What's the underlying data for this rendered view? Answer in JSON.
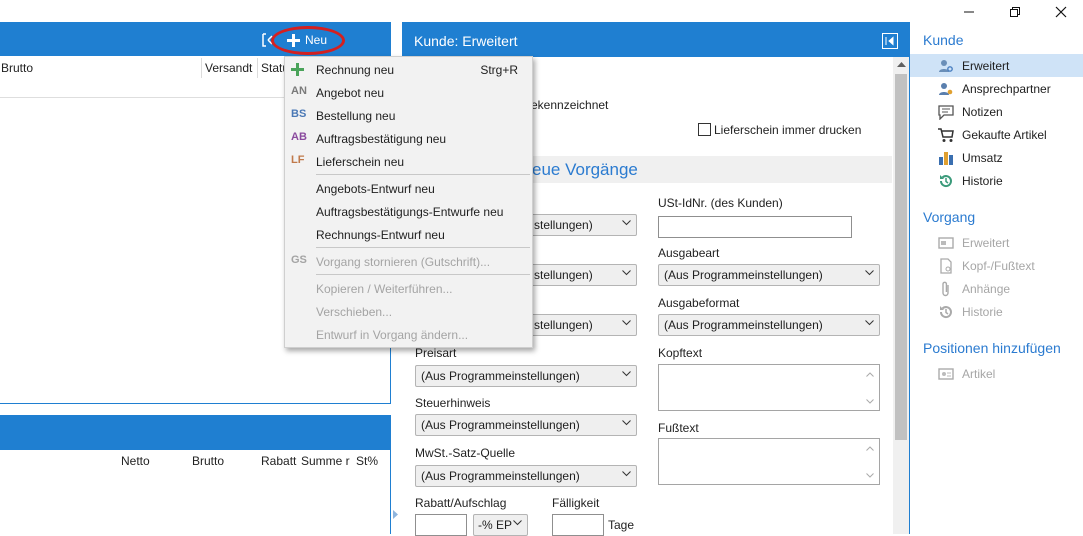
{
  "window": {
    "minimize_icon": "minimize-icon",
    "restore_icon": "restore-icon",
    "close_icon": "close-icon"
  },
  "top_list": {
    "new_button_label": "Neu",
    "columns": [
      "Brutto",
      "Versandt",
      "Status"
    ]
  },
  "bottom_list": {
    "columns": [
      "Netto",
      "Brutto",
      "Rabatt",
      "Summe r",
      "St%"
    ]
  },
  "new_menu": {
    "items": [
      {
        "icon_text": "",
        "icon": "plus-icon",
        "label": "Rechnung neu",
        "shortcut": "Strg+R",
        "color": "#4aa35a",
        "disabled": false
      },
      {
        "icon_text": "AN",
        "label": "Angebot neu",
        "color": "#7a7a7a",
        "disabled": false
      },
      {
        "icon_text": "BS",
        "label": "Bestellung neu",
        "color": "#4a78b5",
        "disabled": false
      },
      {
        "icon_text": "AB",
        "label": "Auftragsbestätigung neu",
        "color": "#8a4a9e",
        "disabled": false
      },
      {
        "icon_text": "LF",
        "label": "Lieferschein neu",
        "color": "#c0794a",
        "disabled": false
      },
      {
        "label": "Angebots-Entwurf neu",
        "disabled": false
      },
      {
        "label": "Auftragsbestätigungs-Entwurfe neu",
        "disabled": false
      },
      {
        "label": "Rechnungs-Entwurf neu",
        "disabled": false
      },
      {
        "icon_text": "GS",
        "label": "Vorgang stornieren (Gutschrift)...",
        "disabled": true
      },
      {
        "label": "Kopieren / Weiterführen...",
        "disabled": true
      },
      {
        "label": "Verschieben...",
        "disabled": true
      },
      {
        "label": "Entwurf in Vorgang ändern...",
        "disabled": true
      }
    ]
  },
  "detail": {
    "title": "Kunde: Erweitert",
    "partial_text_1": "ekennzeichnet",
    "checkbox_label": "Lieferschein immer drucken",
    "section_title": "eue Vorgänge",
    "left_selects": [
      "stellungen)",
      "stellungen)",
      "stellungen)"
    ],
    "ust_label": "USt-IdNr. (des Kunden)",
    "ausgabeart_label": "Ausgabeart",
    "ausgabeart_value": "(Aus Programmeinstellungen)",
    "ausgabeformat_label": "Ausgabeformat",
    "ausgabeformat_value": "(Aus Programmeinstellungen)",
    "preisart_label": "Preisart",
    "preisart_value": "(Aus Programmeinstellungen)",
    "kopftext_label": "Kopftext",
    "steuerhinweis_label": "Steuerhinweis",
    "steuerhinweis_value": "(Aus Programmeinstellungen)",
    "fusstext_label": "Fußtext",
    "mwst_label": "MwSt.-Satz-Quelle",
    "mwst_value": "(Aus Programmeinstellungen)",
    "rabatt_label": "Rabatt/Aufschlag",
    "rabatt_unit": "-% EP",
    "faelligkeit_label": "Fälligkeit",
    "faelligkeit_unit": "Tage"
  },
  "sidebar": {
    "kunde_header": "Kunde",
    "kunde_items": [
      {
        "label": "Erweitert",
        "icon": "person-gear-icon",
        "selected": true,
        "disabled": false
      },
      {
        "label": "Ansprechpartner",
        "icon": "contacts-icon",
        "selected": false,
        "disabled": false
      },
      {
        "label": "Notizen",
        "icon": "notes-icon",
        "selected": false,
        "disabled": false
      },
      {
        "label": "Gekaufte Artikel",
        "icon": "cart-icon",
        "selected": false,
        "disabled": false
      },
      {
        "label": "Umsatz",
        "icon": "bar-chart-icon",
        "selected": false,
        "disabled": false
      },
      {
        "label": "Historie",
        "icon": "history-icon",
        "selected": false,
        "disabled": false
      }
    ],
    "vorgang_header": "Vorgang",
    "vorgang_items": [
      {
        "label": "Erweitert",
        "icon": "window-icon",
        "disabled": true
      },
      {
        "label": "Kopf-/Fußtext",
        "icon": "document-icon",
        "disabled": true
      },
      {
        "label": "Anhänge",
        "icon": "paperclip-icon",
        "disabled": true
      },
      {
        "label": "Historie",
        "icon": "history-icon",
        "disabled": true
      }
    ],
    "positionen_header": "Positionen hinzufügen",
    "positionen_items": [
      {
        "label": "Artikel",
        "icon": "article-icon",
        "disabled": true
      }
    ]
  },
  "colors": {
    "accent": "#1f7fd1",
    "highlight_circle": "#d42020",
    "sidebar_header": "#2b7bd0",
    "selected_bg": "#cfe3f7"
  }
}
